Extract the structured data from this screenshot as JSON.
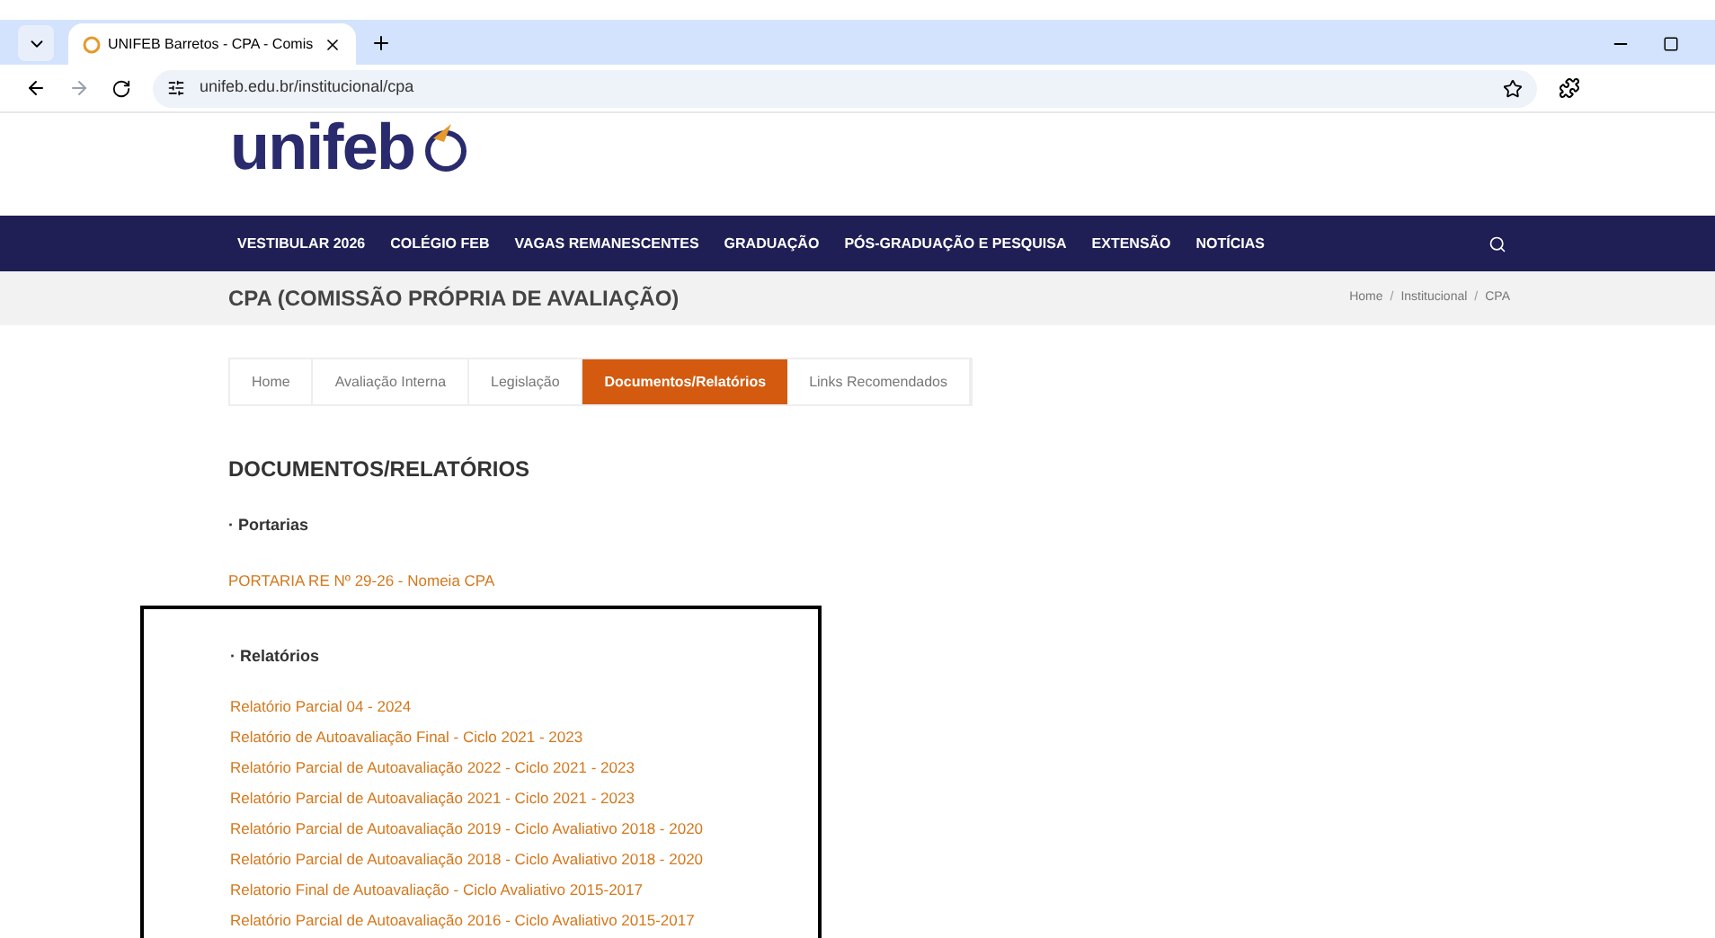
{
  "browser": {
    "tab_title": "UNIFEB Barretos - CPA - Comis",
    "url": "unifeb.edu.br/institucional/cpa"
  },
  "logo": {
    "text": "unifeb"
  },
  "nav": [
    "VESTIBULAR 2026",
    "COLÉGIO FEB",
    "VAGAS REMANESCENTES",
    "GRADUAÇÃO",
    "PÓS-GRADUAÇÃO E PESQUISA",
    "EXTENSÃO",
    "NOTÍCIAS"
  ],
  "page_title": "CPA (COMISSÃO PRÓPRIA DE AVALIAÇÃO)",
  "breadcrumb": [
    {
      "kind": "link",
      "text": "Home"
    },
    {
      "kind": "separator",
      "text": "/"
    },
    {
      "kind": "link",
      "text": "Institucional"
    },
    {
      "kind": "separator",
      "text": "/"
    },
    {
      "kind": "link",
      "text": "CPA"
    }
  ],
  "tabs": [
    {
      "label": "Home",
      "selected": false
    },
    {
      "label": "Avaliação Interna",
      "selected": false
    },
    {
      "label": "Legislação",
      "selected": false
    },
    {
      "label": "Documentos/Relatórios",
      "selected": true
    },
    {
      "label": "Links Recomendados",
      "selected": false
    }
  ],
  "heading": "DOCUMENTOS/RELATÓRIOS",
  "sections": [
    {
      "title": "· Portarias",
      "highlighted": false,
      "links": [
        "PORTARIA RE Nº 29-26 - Nomeia CPA"
      ]
    },
    {
      "title": "· Relatórios",
      "highlighted": true,
      "links": [
        "Relatório Parcial 04 - 2024",
        "Relatório de Autoavaliação Final - Ciclo 2021 - 2023",
        "Relatório Parcial de Autoavaliação 2022 - Ciclo 2021 - 2023",
        "Relatório Parcial de Autoavaliação 2021 - Ciclo 2021 - 2023",
        "Relatório Parcial de Autoavaliação 2019 - Ciclo Avaliativo 2018 - 2020",
        "Relatório Parcial de Autoavaliação 2018 - Ciclo Avaliativo 2018 - 2020",
        "Relatorio Final de Autoavaliação - Ciclo Avaliativo 2015-2017",
        "Relatório Parcial de Autoavaliação 2016 - Ciclo Avaliativo 2015-2017"
      ]
    }
  ]
}
